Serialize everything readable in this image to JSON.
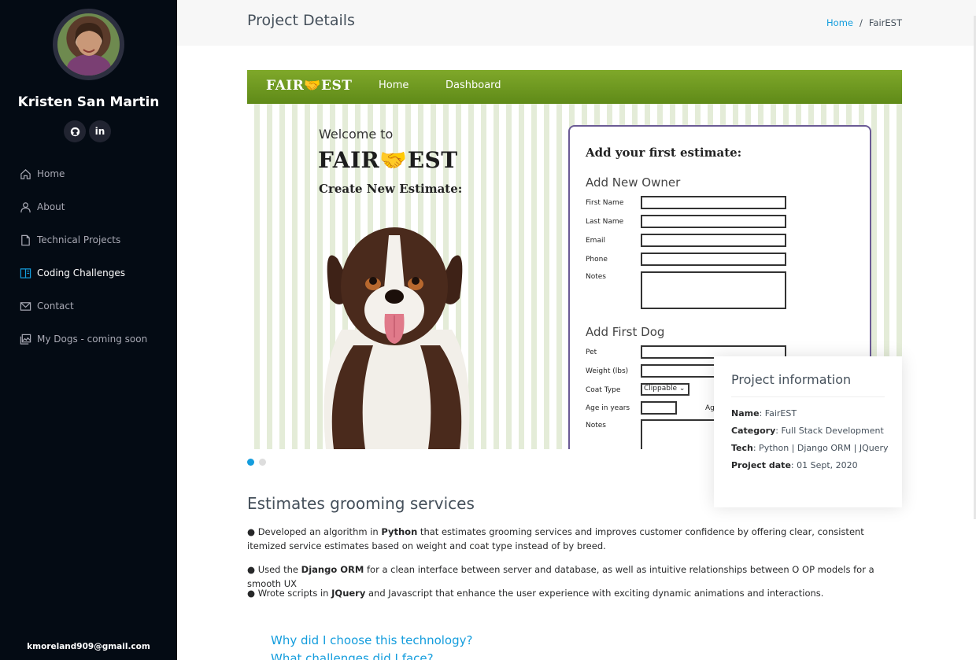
{
  "sidebar": {
    "profile_name": "Kristen San Martin",
    "social": [
      {
        "icon": "github-icon",
        "glyph": "◉"
      },
      {
        "icon": "linkedin-icon",
        "glyph": "in"
      }
    ],
    "nav": [
      {
        "label": "Home",
        "icon": "home-icon"
      },
      {
        "label": "About",
        "icon": "person-icon"
      },
      {
        "label": "Technical Projects",
        "icon": "file-icon"
      },
      {
        "label": "Coding Challenges",
        "icon": "layout-icon",
        "active": true
      },
      {
        "label": "Contact",
        "icon": "envelope-icon"
      },
      {
        "label": "My Dogs - coming soon",
        "icon": "images-icon"
      }
    ],
    "email": "kmoreland909@gmail.com"
  },
  "header": {
    "title": "Project Details",
    "breadcrumb": {
      "home": "Home",
      "separator": "/",
      "current": "FairEST"
    }
  },
  "slide": {
    "logo": "FAIR🤝EST",
    "nav_links": [
      "Home",
      "Dashboard"
    ],
    "welcome": "Welcome to",
    "big_logo": "FAIR🤝EST",
    "create": "Create New Estimate:",
    "form": {
      "title": "Add your first estimate:",
      "owner_heading": "Add New Owner",
      "owner_fields": [
        "First Name",
        "Last Name",
        "Email",
        "Phone",
        "Notes"
      ],
      "dog_heading": "Add First Dog",
      "dog_fields": [
        "Pet",
        "Weight (lbs)",
        "Coat Type",
        "Age in years",
        "Notes"
      ],
      "coat_value": "Clippable ⌄",
      "age_extra": "Ag"
    },
    "total_slides": 2,
    "active_slide": 1
  },
  "info": {
    "title": "Project information",
    "name_label": "Name",
    "name": ": FairEST",
    "category_label": "Category",
    "category": ": Full Stack Development",
    "tech_label": "Tech",
    "tech": ": Python | Django ORM | JQuery",
    "date_label": "Project date",
    "date": ": 01 Sept, 2020"
  },
  "description": {
    "title": "Estimates grooming services",
    "bullets": [
      {
        "pre": "● Developed an algorithm in ",
        "bold": "Python",
        "post": " that estimates grooming services and improves customer confidence by offering clear, consistent itemized service estimates based on weight and coat type instead of by breed."
      },
      {
        "pre": "● Used the ",
        "bold": "Django ORM",
        "post": " for a clean interface between server and database, as well as intuitive relationships between O OP models for a smooth UX"
      },
      {
        "pre": "● Wrote scripts in ",
        "bold": "JQuery",
        "post": " and Javascript that enhance the user experience with exciting dynamic animations and interactions."
      }
    ],
    "links": [
      "Why did I choose this technology?",
      "What challenges did I face?"
    ]
  },
  "colors": {
    "accent": "#149ddd",
    "sidebar_bg": "#040b14",
    "slide_nav": "#6b9620"
  }
}
